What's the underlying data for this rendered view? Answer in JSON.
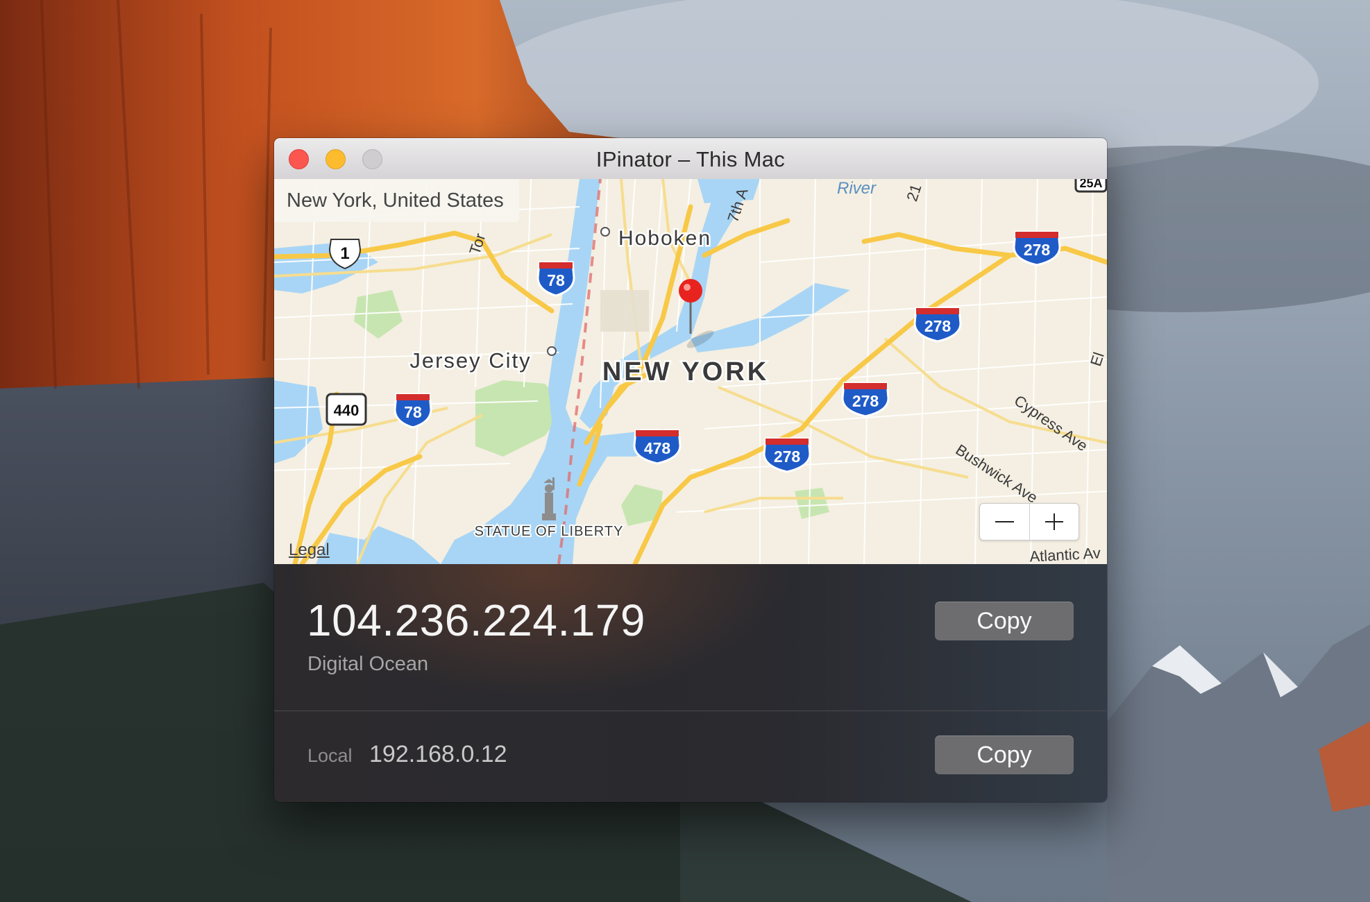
{
  "window": {
    "title": "IPinator – This Mac"
  },
  "map": {
    "location": "New York, United States",
    "legal": "Legal",
    "labels": {
      "hoboken": "Hoboken",
      "jersey_city": "Jersey City",
      "new_york": "NEW YORK",
      "statue": "STATUE OF LIBERTY",
      "river": "River",
      "seventh_ave": "7th A",
      "twenty_first": "21",
      "cypress": "Cypress Ave",
      "bushwick": "Bushwick Ave",
      "atlantic": "Atlantic Av",
      "tor": "Tor",
      "el": "El"
    },
    "shields": [
      "1",
      "78",
      "440",
      "78",
      "478",
      "278",
      "278",
      "278",
      "278",
      "25A"
    ],
    "zoom_out_icon": "minus-icon",
    "zoom_in_icon": "plus-icon"
  },
  "public": {
    "ip": "104.236.224.179",
    "provider": "Digital Ocean",
    "copy_label": "Copy"
  },
  "local": {
    "label": "Local",
    "ip": "192.168.0.12",
    "copy_label": "Copy"
  },
  "colors": {
    "water": "#a8d5f5",
    "land": "#f4efe2",
    "park": "#c7e5b0",
    "highway": "#f8c847",
    "pin": "#e8231f"
  }
}
